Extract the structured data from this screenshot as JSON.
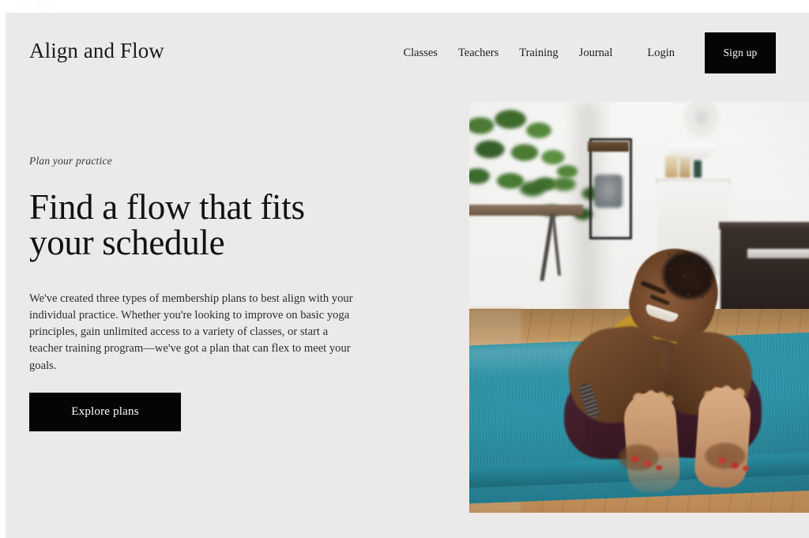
{
  "browser": {
    "dots": [
      "close-dot",
      "minimize-dot",
      "zoom-dot"
    ]
  },
  "header": {
    "brand": "Align and Flow",
    "nav": [
      {
        "label": "Classes",
        "name": "nav-link-classes"
      },
      {
        "label": "Teachers",
        "name": "nav-link-teachers"
      },
      {
        "label": "Training",
        "name": "nav-link-training"
      },
      {
        "label": "Journal",
        "name": "nav-link-journal"
      }
    ],
    "login_label": "Login",
    "signup_label": "Sign up"
  },
  "hero": {
    "eyebrow": "Plan your practice",
    "title": "Find a flow that fits your schedule",
    "body": "We've created three types of membership plans to best align with your individual practice. Whether you're looking to improve on basic yoga principles, gain unlimited access to a variety of classes, or start a teacher training program—we've got a plan that can flex to meet your goals.",
    "cta_label": "Explore plans",
    "image_alt": "Smiling woman in a mustard tank top and maroon leggings seated on a teal yoga mat doing a seated forward fold stretch in a bright room with a wooden floor and a green plant"
  },
  "colors": {
    "page_background": "#eceae8",
    "accent_dark": "#050505",
    "text_primary": "#121212",
    "text_body": "#2c2c2c",
    "mat_teal": "#2d93a7",
    "tank_mustard": "#c79a2c",
    "floor_wood": "#cf9f68"
  }
}
